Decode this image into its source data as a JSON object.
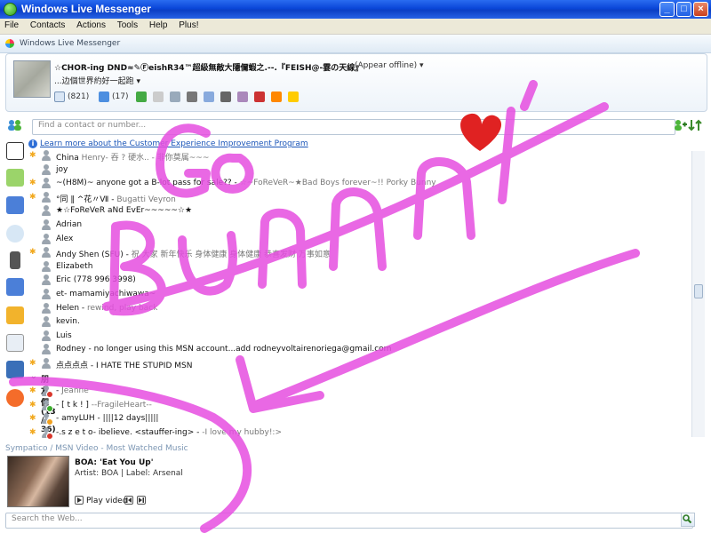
{
  "window": {
    "title": "Windows Live Messenger",
    "minimize_label": "_",
    "maximize_label": "□",
    "close_label": "×"
  },
  "menu": [
    "File",
    "Contacts",
    "Actions",
    "Tools",
    "Help",
    "Plus!"
  ],
  "brand": "Windows Live Messenger",
  "profile": {
    "name": "☆CHOR-ing DND≈✎ⒻeishR34™超級無敵大隱儞蝦之.--.『FEISH@-霎の天線』",
    "status": "(Appear offline)",
    "personal_message": "...边個世界約好一起跑",
    "mail_count": "(821)",
    "spaces_count": "(17)"
  },
  "search": {
    "placeholder": "Find a contact or number..."
  },
  "info_link": "Learn more about the Customer Experience Improvement Program",
  "contacts": [
    {
      "starred": true,
      "name": "China",
      "pm": " Henry- 吞 ? 硬水.. - 非你莫属~~~"
    },
    {
      "starred": false,
      "name": "joy",
      "pm": ""
    },
    {
      "starred": true,
      "name": "~(H8M)~ anyone got a B-lot pass for sale?? -",
      "pm": " ☆~FoReVeR~★Bad Boys forever~!! Porky  Bunny"
    },
    {
      "starred": true,
      "name": "°同 ‖ ^花〃Ⅶ -",
      "pm": " Bugatti Veyron"
    },
    {
      "starred": false,
      "name": "★☆FoReVeR aNd EvEr~~~~~☆★",
      "pm": ""
    },
    {
      "starred": false,
      "name": "Adrian",
      "pm": ""
    },
    {
      "starred": false,
      "name": "Alex",
      "pm": ""
    },
    {
      "starred": true,
      "name": "Andy Shen (SFU) -",
      "pm": " 祝 大家 新年快乐 身体健康 身体健康 恭喜发财 万事如意"
    },
    {
      "starred": false,
      "name": "Elizabeth",
      "pm": ""
    },
    {
      "starred": false,
      "name": "Eric (778 996 3998)",
      "pm": ""
    },
    {
      "starred": false,
      "name": "et- mamamiyachiwawa~",
      "pm": ""
    },
    {
      "starred": false,
      "name": "Helen -",
      "pm": " rewind, play back"
    },
    {
      "starred": false,
      "name": "kevin.",
      "pm": ""
    },
    {
      "starred": false,
      "name": "Luis",
      "pm": ""
    },
    {
      "starred": false,
      "name": "Rodney - no longer using this MSN account...add rodneyvoltairenoriega@gmail.com",
      "pm": ""
    },
    {
      "starred": true,
      "name": "点点点点 - I HATE THE STUPID MSN",
      "pm": ""
    }
  ],
  "group": {
    "label": "朋友們 (13 / 36)"
  },
  "group_contacts": [
    {
      "starred": true,
      "name": "-",
      "pm": "  Jeanne"
    },
    {
      "starred": true,
      "name": "- [ t k ! ]",
      "pm": "      --FragileHeart--"
    },
    {
      "starred": true,
      "name": "- amyLUH - ||||12 days|||||",
      "pm": ""
    },
    {
      "starred": true,
      "name": "-.s z e t o- ibelieve.  <stauffer-ing> -",
      "pm": " -I love my hubby!:>"
    }
  ],
  "video": {
    "header": "Sympatico / MSN Video - Most Watched Music",
    "title": "BOA: 'Eat You Up'",
    "meta": "Artist: BOA | Label: Arsenal",
    "play_label": "Play video"
  },
  "web_search": {
    "placeholder": "Search the Web..."
  },
  "colors": {
    "online": "#3cae2e",
    "offline": "#9aa4ae",
    "busy": "#d9362b",
    "away": "#f0a020",
    "scribble": "#e64ee0",
    "heart": "#e02222"
  }
}
